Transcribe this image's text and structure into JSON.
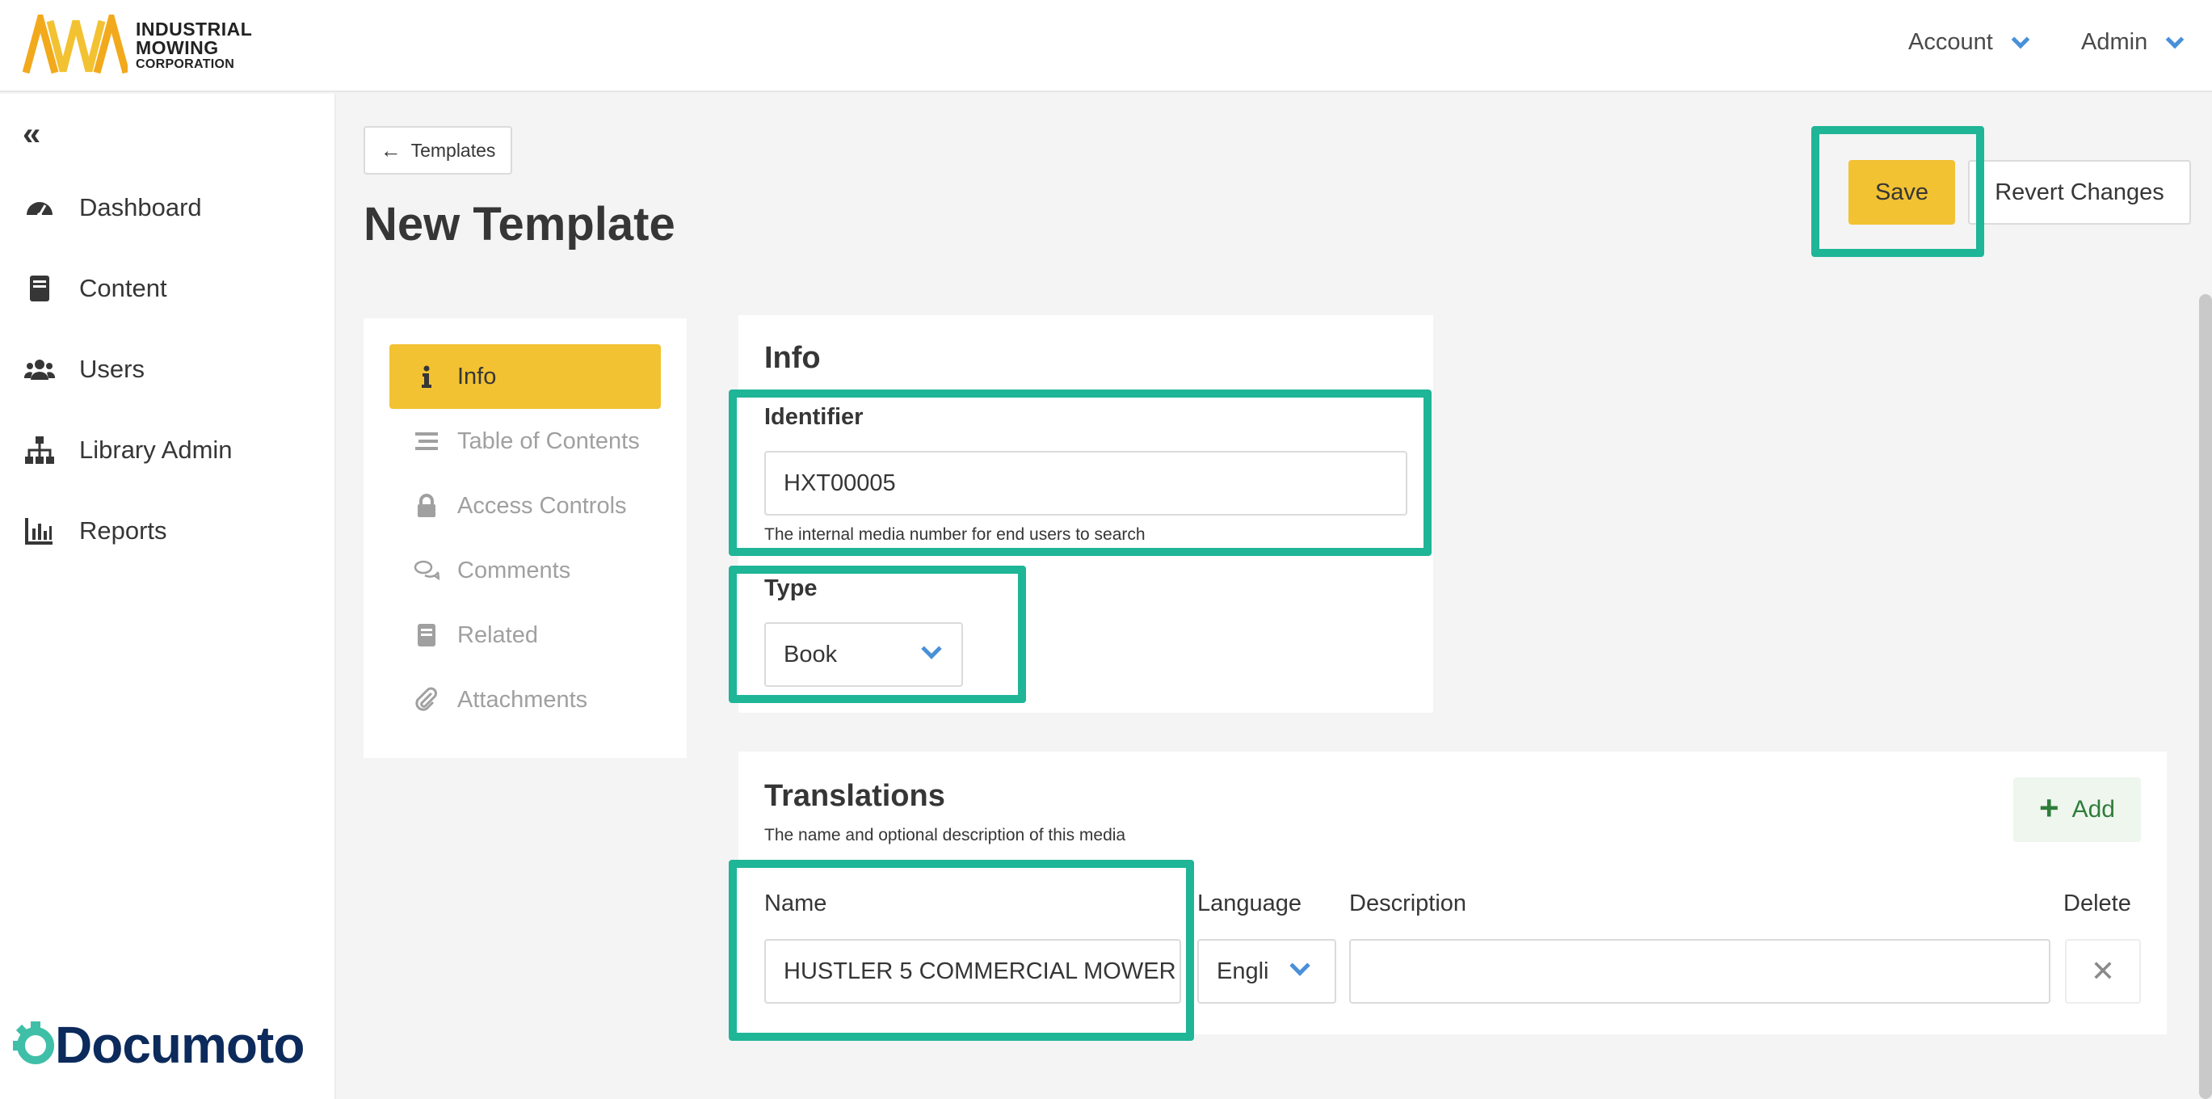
{
  "logo": {
    "line1": "INDUSTRIAL",
    "line2": "MOWING",
    "line3": "CORPORATION"
  },
  "topnav": {
    "account_label": "Account",
    "admin_label": "Admin"
  },
  "sidebar": {
    "items": [
      {
        "label": "Dashboard",
        "icon": "dashboard-icon"
      },
      {
        "label": "Content",
        "icon": "book-icon"
      },
      {
        "label": "Users",
        "icon": "users-icon"
      },
      {
        "label": "Library Admin",
        "icon": "sitemap-icon"
      },
      {
        "label": "Reports",
        "icon": "chart-icon"
      }
    ],
    "brand": "Documoto"
  },
  "header": {
    "back_label": "Templates",
    "title": "New Template"
  },
  "actions": {
    "save_label": "Save",
    "revert_label": "Revert Changes"
  },
  "tabs": [
    {
      "label": "Info",
      "icon": "info-icon"
    },
    {
      "label": "Table of Contents",
      "icon": "list-icon"
    },
    {
      "label": "Access Controls",
      "icon": "lock-icon"
    },
    {
      "label": "Comments",
      "icon": "comments-icon"
    },
    {
      "label": "Related",
      "icon": "book-icon"
    },
    {
      "label": "Attachments",
      "icon": "paperclip-icon"
    }
  ],
  "info": {
    "title": "Info",
    "identifier_label": "Identifier",
    "identifier_value": "HXT00005",
    "identifier_help": "The internal media number for end users to search",
    "type_label": "Type",
    "type_value": "Book"
  },
  "translations": {
    "title": "Translations",
    "subtitle": "The name and optional description of this media",
    "add_label": "Add",
    "col_name": "Name",
    "col_language": "Language",
    "col_description": "Description",
    "col_delete": "Delete",
    "row": {
      "name": "HUSTLER 5 COMMERCIAL MOWER",
      "language": "Engli",
      "description": ""
    }
  },
  "colors": {
    "accent": "#f2c232",
    "highlight": "#1fb597",
    "link_blue": "#4a90d9",
    "add_green": "#2f7d3a"
  }
}
